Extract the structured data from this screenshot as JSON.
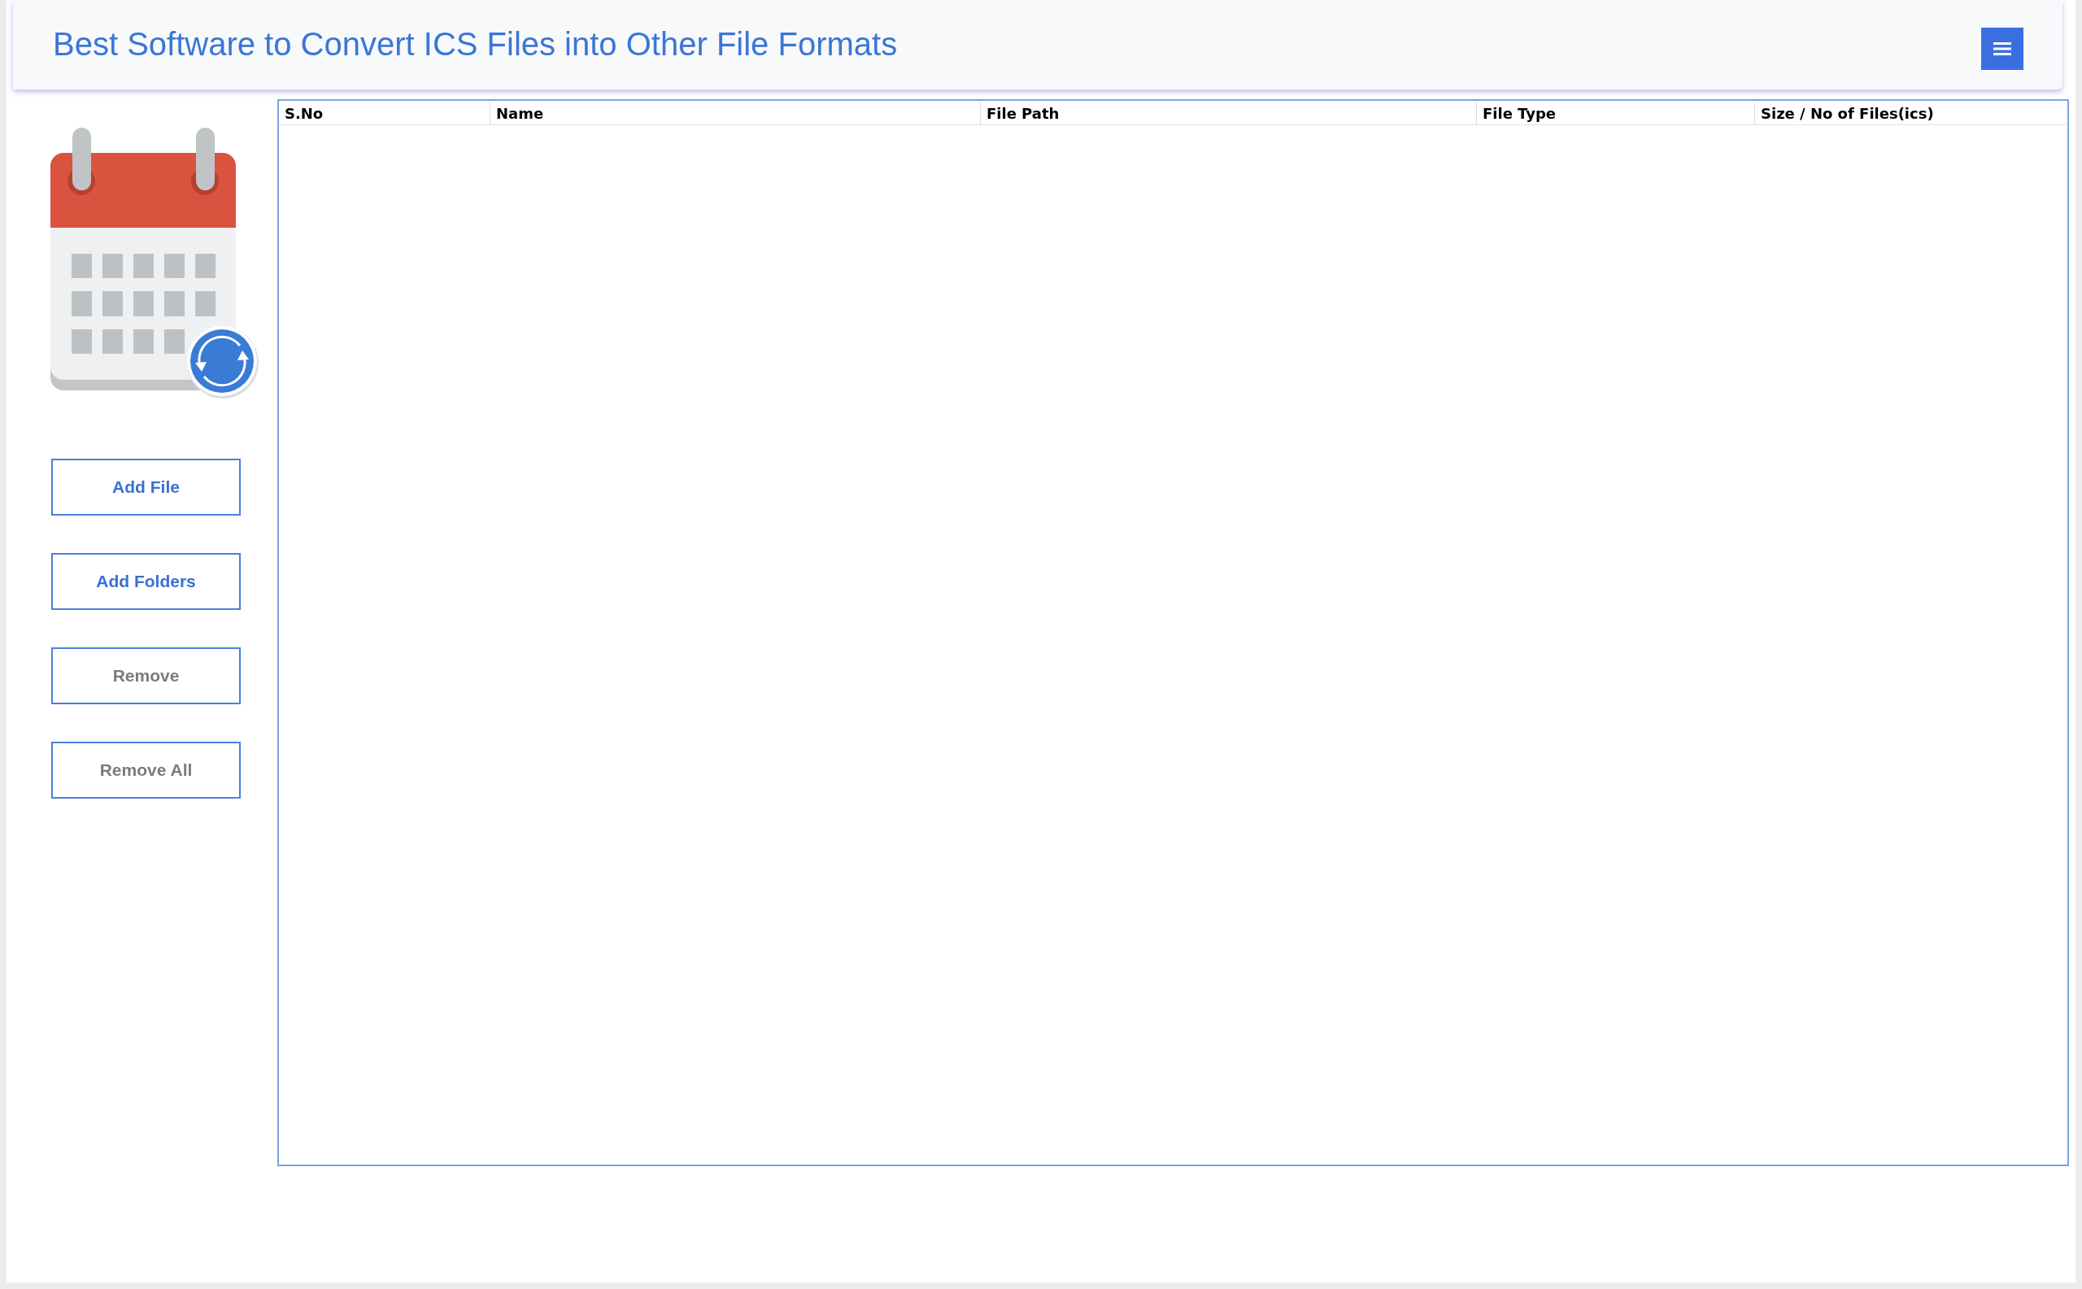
{
  "header": {
    "title": "Best Software to Convert ICS Files into Other File Formats"
  },
  "sidebar": {
    "buttons": [
      {
        "label": "Add File",
        "disabled": false
      },
      {
        "label": "Add Folders",
        "disabled": false
      },
      {
        "label": "Remove",
        "disabled": true
      },
      {
        "label": "Remove All",
        "disabled": true
      }
    ]
  },
  "table": {
    "columns": [
      "S.No",
      "Name",
      "File Path",
      "File Type",
      "Size / No of Files(ics)"
    ]
  }
}
